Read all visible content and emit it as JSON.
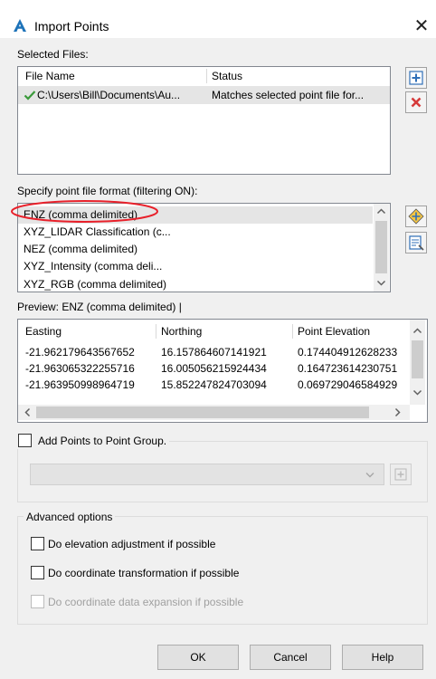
{
  "dialog": {
    "title": "Import Points",
    "close_glyph": "✕"
  },
  "selected_files": {
    "label": "Selected Files:",
    "columns": [
      "File Name",
      "Status"
    ],
    "rows": [
      {
        "file_name": "C:\\Users\\Bill\\Documents\\Au...",
        "status": "Matches selected point file for..."
      }
    ],
    "icons": {
      "row_status": "checkmark-icon",
      "add": "add-file-icon",
      "remove": "remove-file-icon"
    },
    "colors": {
      "check": "#3a9a3a",
      "remove": "#d63a3a",
      "add": "#2f6fb7"
    }
  },
  "format": {
    "label": "Specify point file format (filtering ON):",
    "items": [
      "ENZ (comma delimited)",
      "XYZ_LIDAR Classification (c...",
      "NEZ (comma delimited)",
      "XYZ_Intensity (comma deli...",
      "XYZ_RGB (comma delimited)"
    ],
    "selected_index": 0,
    "highlight_color": "#e8202a",
    "icons": {
      "manage": "manage-formats-icon",
      "detect": "detect-format-icon"
    }
  },
  "preview": {
    "label": "Preview: ENZ (comma delimited) |",
    "columns": [
      "Easting",
      "Northing",
      "Point Elevation"
    ],
    "rows": [
      [
        "-21.962179643567652",
        "16.157864607141921",
        "0.174404912628233"
      ],
      [
        "-21.963065322255716",
        "16.005056215924434",
        "0.164723614230751"
      ],
      [
        "-21.963950998964719",
        "15.852247824703094",
        "0.069729046584929"
      ]
    ]
  },
  "point_group": {
    "checkbox_label": "Add Points to Point Group.",
    "checked": false,
    "dropdown_value": "",
    "icons": {
      "dropdown": "chevron-down-icon",
      "create": "create-point-group-icon"
    }
  },
  "advanced": {
    "label": "Advanced options",
    "options": [
      {
        "label": "Do elevation adjustment if possible",
        "checked": false,
        "enabled": true
      },
      {
        "label": "Do coordinate transformation if possible",
        "checked": false,
        "enabled": true
      },
      {
        "label": "Do coordinate data expansion if possible",
        "checked": false,
        "enabled": false
      }
    ]
  },
  "buttons": {
    "ok": "OK",
    "cancel": "Cancel",
    "help": "Help"
  },
  "colors": {
    "accent": "#0078d7",
    "selected_row": "#e5e5e5",
    "window_bg": "#f0f0f0"
  }
}
